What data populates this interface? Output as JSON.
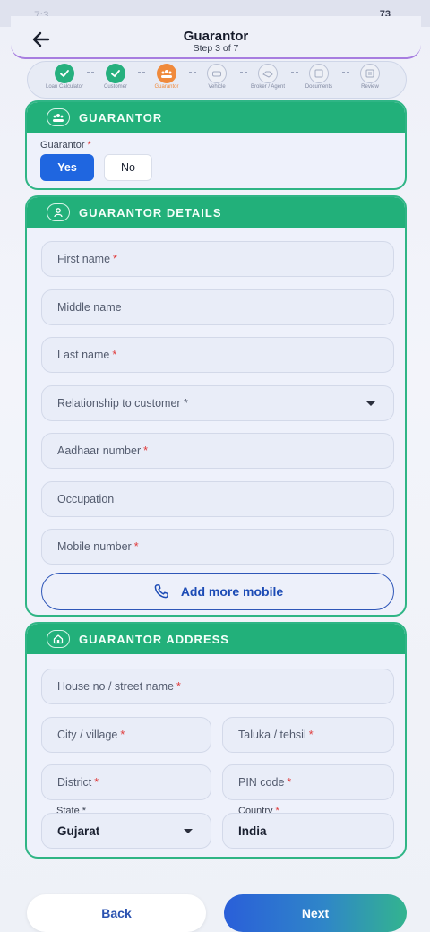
{
  "status_bar": {
    "time": "7:3",
    "battery": "73"
  },
  "header": {
    "title": "Guarantor",
    "subtitle": "Step 3 of 7",
    "back_icon": "arrow-left-icon"
  },
  "stepper": {
    "steps": [
      {
        "label": "Loan Calculator",
        "state": "done"
      },
      {
        "label": "Customer",
        "state": "done"
      },
      {
        "label": "Guarantor",
        "state": "current"
      },
      {
        "label": "Vehicle",
        "state": "todo"
      },
      {
        "label": "Broker / Agent",
        "state": "todo"
      },
      {
        "label": "Documents",
        "state": "todo"
      },
      {
        "label": "Review",
        "state": "todo"
      }
    ]
  },
  "guarantor_card": {
    "title": "GUARANTOR",
    "icon": "people-icon",
    "field_label": "Guarantor",
    "yes_label": "Yes",
    "no_label": "No",
    "selected": "Yes"
  },
  "details_card": {
    "title": "GUARANTOR DETAILS",
    "icon": "person-icon",
    "first_name": "First name",
    "middle_name": "Middle name",
    "last_name": "Last name",
    "relationship": "Relationship to customer *",
    "aadhaar": "Aadhaar number",
    "occupation": "Occupation",
    "mobile": "Mobile number",
    "add_mobile": "Add more mobile"
  },
  "address_card": {
    "title": "GUARANTOR ADDRESS",
    "icon": "home-icon",
    "house": "House no / street name",
    "city": "City / village",
    "taluka": "Taluka / tehsil",
    "district": "District",
    "pin": "PIN code",
    "state_label": "State *",
    "state_value": "Gujarat",
    "country_label": "Country",
    "country_value": "India"
  },
  "footer": {
    "back_label": "Back",
    "next_label": "Next"
  },
  "colors": {
    "accent_green": "#22b07a",
    "primary_blue": "#1f66e0",
    "current_step": "#f08a3c",
    "required": "#e03a3a"
  }
}
